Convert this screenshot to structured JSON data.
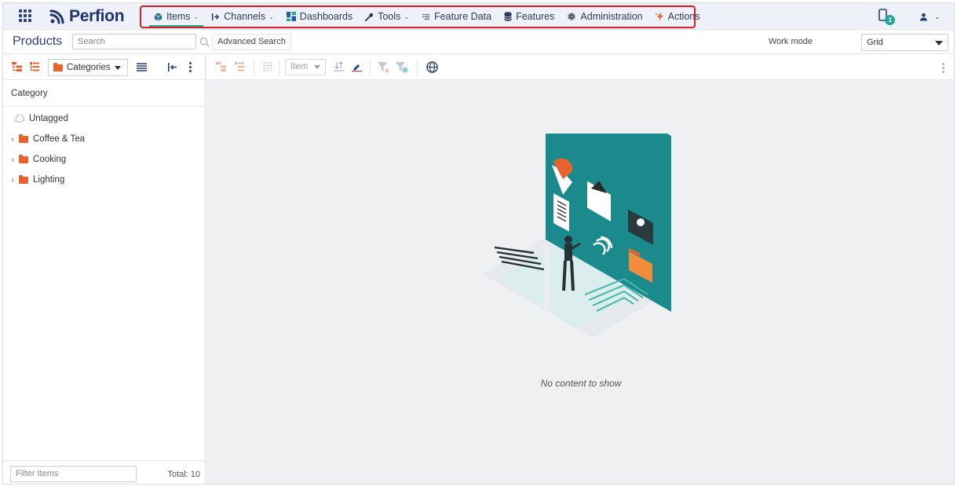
{
  "app": {
    "logo_text": "Perfion"
  },
  "nav": {
    "items": [
      {
        "label": "Items",
        "icon": "cube-icon",
        "has_caret": true,
        "active": true
      },
      {
        "label": "Channels",
        "icon": "channel-arrow-icon",
        "has_caret": true
      },
      {
        "label": "Dashboards",
        "icon": "dashboard-grid-icon"
      },
      {
        "label": "Tools",
        "icon": "wrench-icon",
        "has_caret": true
      },
      {
        "label": "Feature Data",
        "icon": "list-lines-icon"
      },
      {
        "label": "Features",
        "icon": "database-icon"
      },
      {
        "label": "Administration",
        "icon": "gear-icon"
      },
      {
        "label": "Actions",
        "icon": "lightning-icon"
      }
    ],
    "notification_count": "1"
  },
  "header": {
    "title": "Products",
    "search_placeholder": "Search",
    "advanced_search_label": "Advanced Search",
    "work_mode_label": "Work mode",
    "work_mode_value": "Grid"
  },
  "left_panel": {
    "view_select": "Categories",
    "column_header": "Category",
    "tree": [
      {
        "label": "Untagged",
        "type": "tag"
      },
      {
        "label": "Coffee & Tea",
        "type": "folder"
      },
      {
        "label": "Cooking",
        "type": "folder"
      },
      {
        "label": "Lighting",
        "type": "folder"
      }
    ],
    "filter_placeholder": "Filter Items",
    "total_text": "Total: 10"
  },
  "main": {
    "item_select": "Item",
    "empty_message": "No content to show"
  },
  "colors": {
    "brand": "#1f3470",
    "accent": "#26a69a",
    "folder": "#e8632c",
    "highlight_border": "#e01b24"
  }
}
